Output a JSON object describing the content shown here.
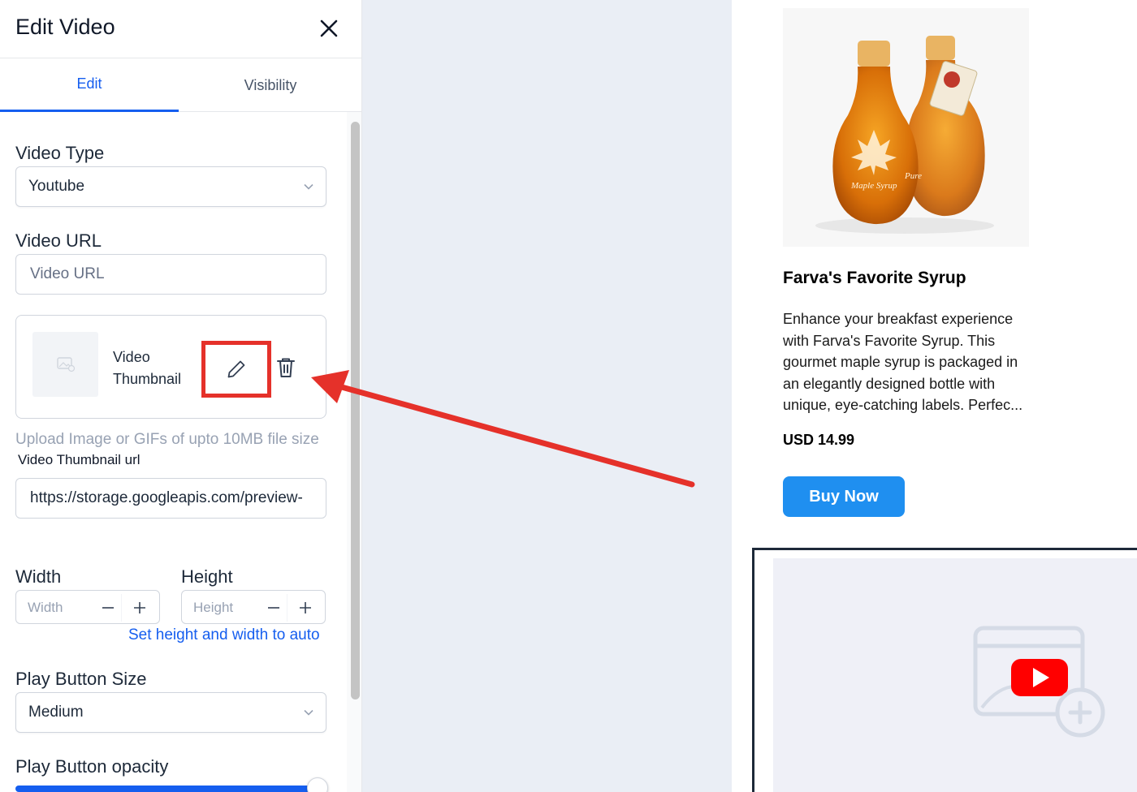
{
  "panel": {
    "title": "Edit Video",
    "tabs": [
      {
        "label": "Edit",
        "active": true
      },
      {
        "label": "Visibility",
        "active": false
      }
    ]
  },
  "form": {
    "video_type": {
      "label": "Video Type",
      "value": "Youtube"
    },
    "video_url": {
      "label": "Video URL",
      "placeholder": "Video URL",
      "value": ""
    },
    "thumbnail": {
      "label": "Video Thumbnail"
    },
    "upload_hint": "Upload Image or GIFs of upto 10MB file size",
    "thumbnail_url": {
      "label": "Video Thumbnail url",
      "value": "https://storage.googleapis.com/preview-"
    },
    "width": {
      "label": "Width",
      "placeholder": "Width"
    },
    "height": {
      "label": "Height",
      "placeholder": "Height"
    },
    "auto_size_link": "Set height and width to auto",
    "play_button_size": {
      "label": "Play Button Size",
      "value": "Medium"
    },
    "play_button_opacity": {
      "label": "Play Button opacity",
      "value_fraction": 0.97
    }
  },
  "product": {
    "title": "Farva's Favorite Syrup",
    "description": "Enhance your breakfast experience with Farva's Favorite Syrup. This gourmet maple syrup is packaged in an elegantly designed bottle with unique, eye-catching labels. Perfec...",
    "price": "USD 14.99",
    "buy_label": "Buy Now",
    "image_label_line1": "Pure",
    "image_label_line2": "Maple Syrup"
  },
  "colors": {
    "accent": "#155eef",
    "buy_button": "#1f8ff0",
    "annotation": "#e5312a",
    "canvas": "#eaeef5",
    "youtube_red": "#ff0000"
  },
  "icons": [
    "close-icon",
    "chevron-down-icon",
    "image-placeholder-icon",
    "pencil-icon",
    "trash-icon",
    "minus-icon",
    "plus-icon",
    "youtube-play-icon",
    "add-circle-icon"
  ]
}
